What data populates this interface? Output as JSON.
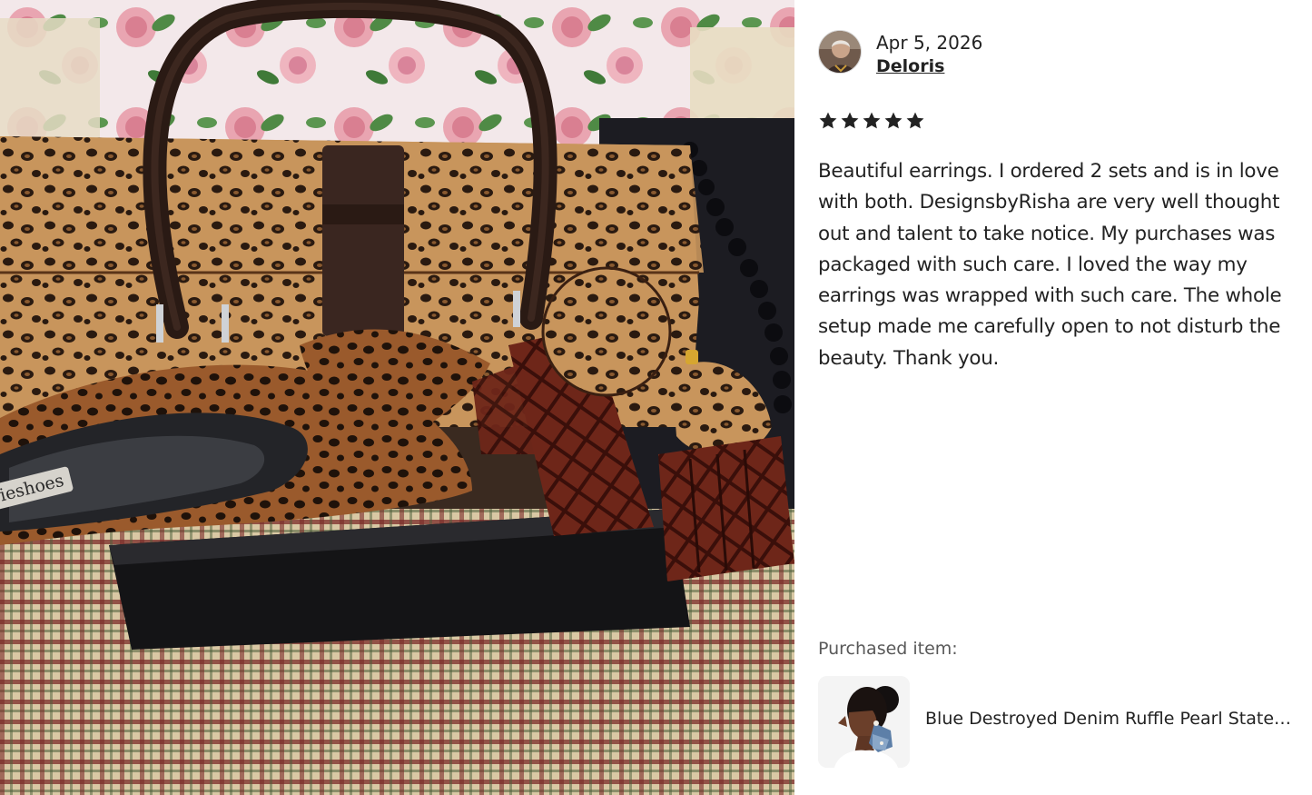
{
  "review": {
    "date": "Apr 5, 2026",
    "reviewer_name": "Deloris",
    "rating": 5,
    "rating_max": 5,
    "text": "Beautiful earrings. I ordered 2 sets and is in love with both. DesignsbyRisha are very well thought out and talent to take notice. My purchases was packaged with such care. I loved the way my earrings was wrapped with such care. The whole setup made me carefully open to not disturb the beauty. Thank you."
  },
  "photo": {
    "insole_text": "ieshoes"
  },
  "purchased": {
    "label": "Purchased item:",
    "item_title": "Blue Destroyed Denim Ruffle Pearl Stateme..."
  },
  "icons": {
    "star": "star-icon"
  },
  "colors": {
    "star": "#222222",
    "link": "#222222",
    "muted": "#595959"
  }
}
